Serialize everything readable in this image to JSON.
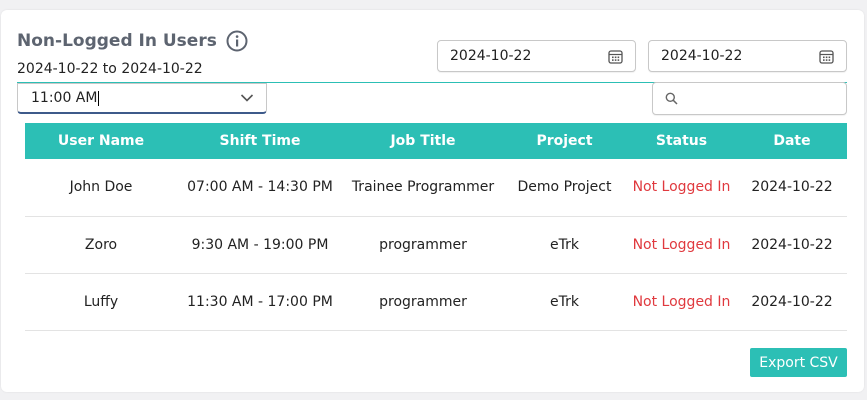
{
  "header": {
    "title": "Non-Logged In Users",
    "date_range": "2024-10-22 to 2024-10-22"
  },
  "filters": {
    "start_date": "2024-10-22",
    "end_date": "2024-10-22",
    "time_value": "11:00 AM",
    "search_placeholder": ""
  },
  "table": {
    "columns": [
      "User Name",
      "Shift Time",
      "Job Title",
      "Project",
      "Status",
      "Date"
    ],
    "rows": [
      {
        "user": "John Doe",
        "shift": "07:00 AM - 14:30 PM",
        "job": "Trainee Programmer",
        "project": "Demo Project",
        "status": "Not Logged In",
        "date": "2024-10-22"
      },
      {
        "user": "Zoro",
        "shift": "9:30 AM - 19:00 PM",
        "job": "programmer",
        "project": "eTrk",
        "status": "Not Logged In",
        "date": "2024-10-22"
      },
      {
        "user": "Luffy",
        "shift": "11:30 AM - 17:00 PM",
        "job": "programmer",
        "project": "eTrk",
        "status": "Not Logged In",
        "date": "2024-10-22"
      }
    ]
  },
  "actions": {
    "export_label": "Export CSV"
  },
  "colors": {
    "accent": "#2cbfb5",
    "status_not_logged": "#e0393e",
    "title": "#5d6470"
  },
  "icons": {
    "info": "info-icon",
    "calendar": "calendar-icon",
    "chevron": "chevron-down-icon",
    "search": "search-icon"
  }
}
